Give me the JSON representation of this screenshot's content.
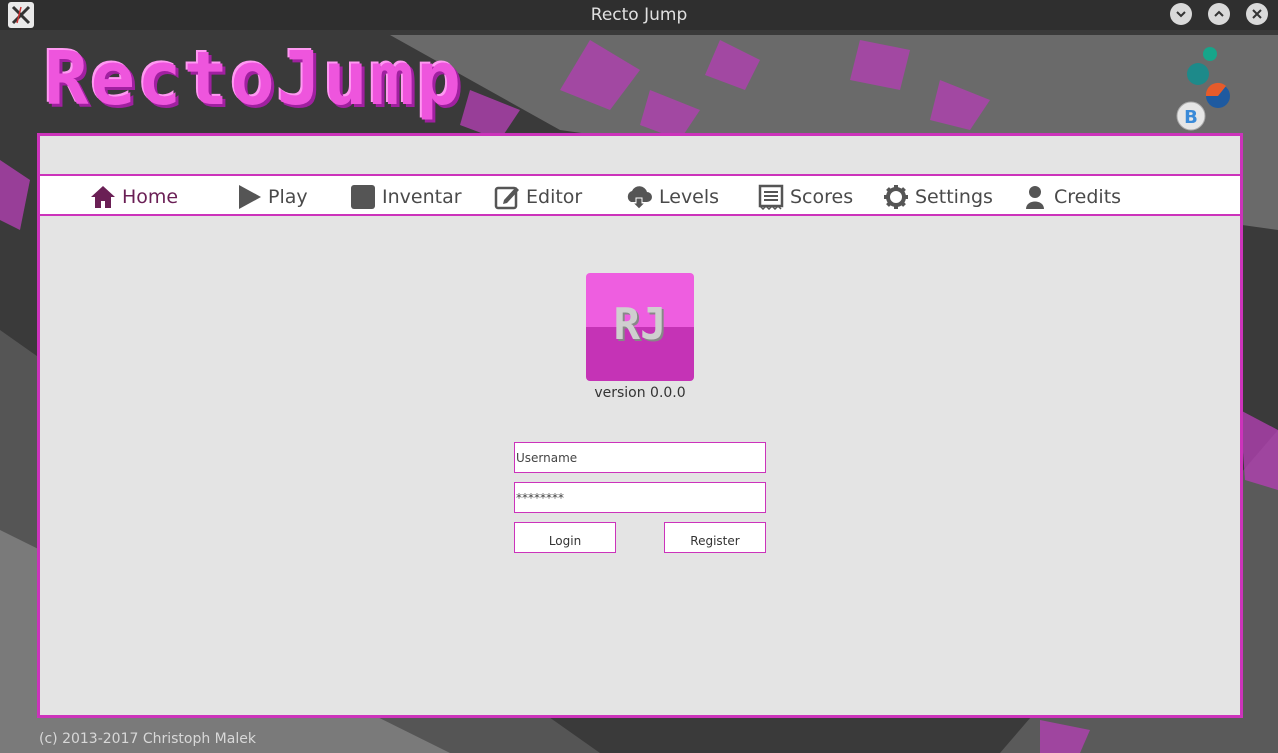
{
  "window": {
    "title": "Recto Jump"
  },
  "logo": {
    "text": "RectoJump"
  },
  "nav": {
    "items": [
      {
        "label": "Home",
        "icon": "home-icon"
      },
      {
        "label": "Play",
        "icon": "play-icon"
      },
      {
        "label": "Inventar",
        "icon": "square-icon"
      },
      {
        "label": "Editor",
        "icon": "edit-icon"
      },
      {
        "label": "Levels",
        "icon": "cloud-download-icon"
      },
      {
        "label": "Scores",
        "icon": "list-icon"
      },
      {
        "label": "Settings",
        "icon": "gear-icon"
      },
      {
        "label": "Credits",
        "icon": "user-icon"
      }
    ],
    "active": "Home"
  },
  "app_logo": {
    "text": "RJ"
  },
  "version": "version 0.0.0",
  "login": {
    "username_placeholder": "Username",
    "password_value": "********",
    "login_label": "Login",
    "register_label": "Register"
  },
  "badge": {
    "letter": "B"
  },
  "footer": {
    "copyright": "(c) 2013-2017 Christoph Malek"
  },
  "colors": {
    "accent": "#cc33bb",
    "panel_bg": "#e4e4e4",
    "active_nav": "#6a1f55"
  }
}
